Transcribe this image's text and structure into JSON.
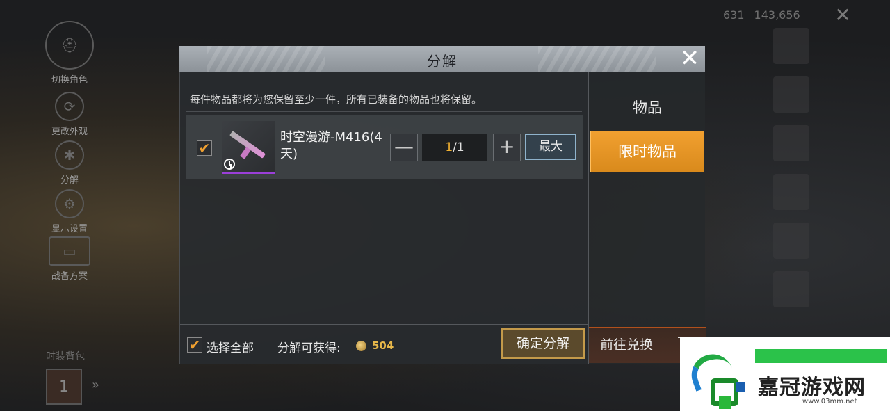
{
  "background": {
    "left_menu": [
      {
        "label": "切换角色",
        "icon": "helmet-icon"
      },
      {
        "label": "更改外观",
        "icon": "refresh-icon"
      },
      {
        "label": "分解",
        "icon": "split-icon"
      },
      {
        "label": "显示设置",
        "icon": "gear-icon"
      },
      {
        "label": "战备方案",
        "icon": "crate-icon"
      }
    ],
    "currency": {
      "uc": "631",
      "bp": "143,656"
    },
    "wardrobe_label": "时装背包",
    "wardrobe_count": "1",
    "top_close": "✕"
  },
  "dialog": {
    "title": "分解",
    "close": "✕",
    "notice": "每件物品都将为您保留至少一件，所有已装备的物品也将保留。",
    "item": {
      "name": "时空漫游-M416(4天)",
      "checked": "✔",
      "qty_current": "1",
      "qty_total": "/1",
      "minus": "—",
      "plus": "+",
      "max_label": "最大",
      "rarity_color": "#9b3fd9"
    },
    "footer": {
      "select_all_check": "✔",
      "select_all_label": "选择全部",
      "yield_label": "分解可获得:",
      "yield_value": "504",
      "confirm_label": "确定分解"
    },
    "side": {
      "tab_items": "物品",
      "tab_limited": "限时物品",
      "exchange_label": "前往兑换",
      "accent_color": "#f1a030"
    }
  },
  "watermark": {
    "title": "嘉冠游戏网",
    "url": "www.03mm.net"
  }
}
